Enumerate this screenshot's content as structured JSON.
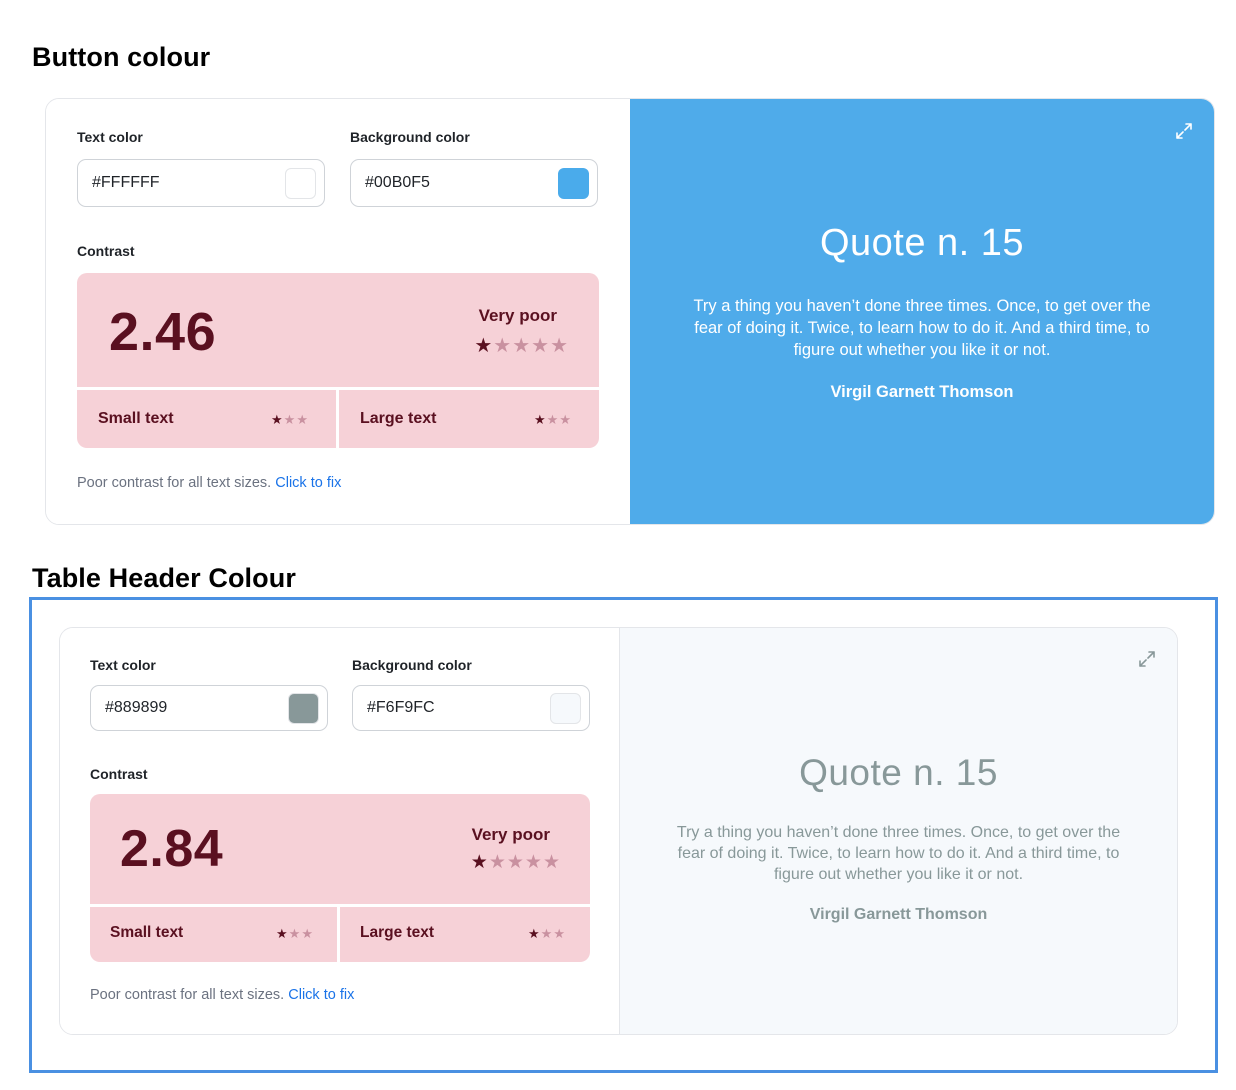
{
  "sections": [
    {
      "title": "Button colour",
      "text_color_label": "Text color",
      "text_color_value": "#FFFFFF",
      "text_swatch_color": "#FFFFFF",
      "bg_color_label": "Background color",
      "bg_color_value": "#00B0F5",
      "bg_swatch_color": "#4AABEB",
      "contrast_label": "Contrast",
      "ratio": "2.46",
      "rating": "Very poor",
      "rating_stars": 1,
      "small_text_label": "Small text",
      "small_text_stars": 1,
      "large_text_label": "Large text",
      "large_text_stars": 1,
      "hint_text": "Poor contrast for all text sizes.",
      "hint_link": "Click to fix",
      "preview_bg": "#4FABEA",
      "preview_fg": "#FFFFFF",
      "quote_title": "Quote n. 15",
      "quote_text": "Try a thing you haven’t done three times. Once, to get over the fear of doing it. Twice, to learn how to do it. And a third time, to figure out whether you like it or not.",
      "quote_author": "Virgil Garnett Thomson",
      "expand_icon": "expand-icon"
    },
    {
      "title": "Table Header Colour",
      "text_color_label": "Text color",
      "text_color_value": "#889899",
      "text_swatch_color": "#889899",
      "bg_color_label": "Background color",
      "bg_color_value": "#F6F9FC",
      "bg_swatch_color": "#F6F9FC",
      "contrast_label": "Contrast",
      "ratio": "2.84",
      "rating": "Very poor",
      "rating_stars": 1,
      "small_text_label": "Small text",
      "small_text_stars": 1,
      "large_text_label": "Large text",
      "large_text_stars": 1,
      "hint_text": "Poor contrast for all text sizes.",
      "hint_link": "Click to fix",
      "preview_bg": "#F6F9FC",
      "preview_fg": "#889899",
      "quote_title": "Quote n. 15",
      "quote_text": "Try a thing you haven’t done three times. Once, to get over the fear of doing it. Twice, to learn how to do it. And a third time, to figure out whether you like it or not.",
      "quote_author": "Virgil Garnett Thomson",
      "expand_icon": "expand-icon"
    }
  ],
  "colors": {
    "contrast_box_bg": "#F6D1D7",
    "contrast_text": "#5A1020",
    "link": "#1A73E8",
    "focus_frame": "#4A90E2"
  }
}
